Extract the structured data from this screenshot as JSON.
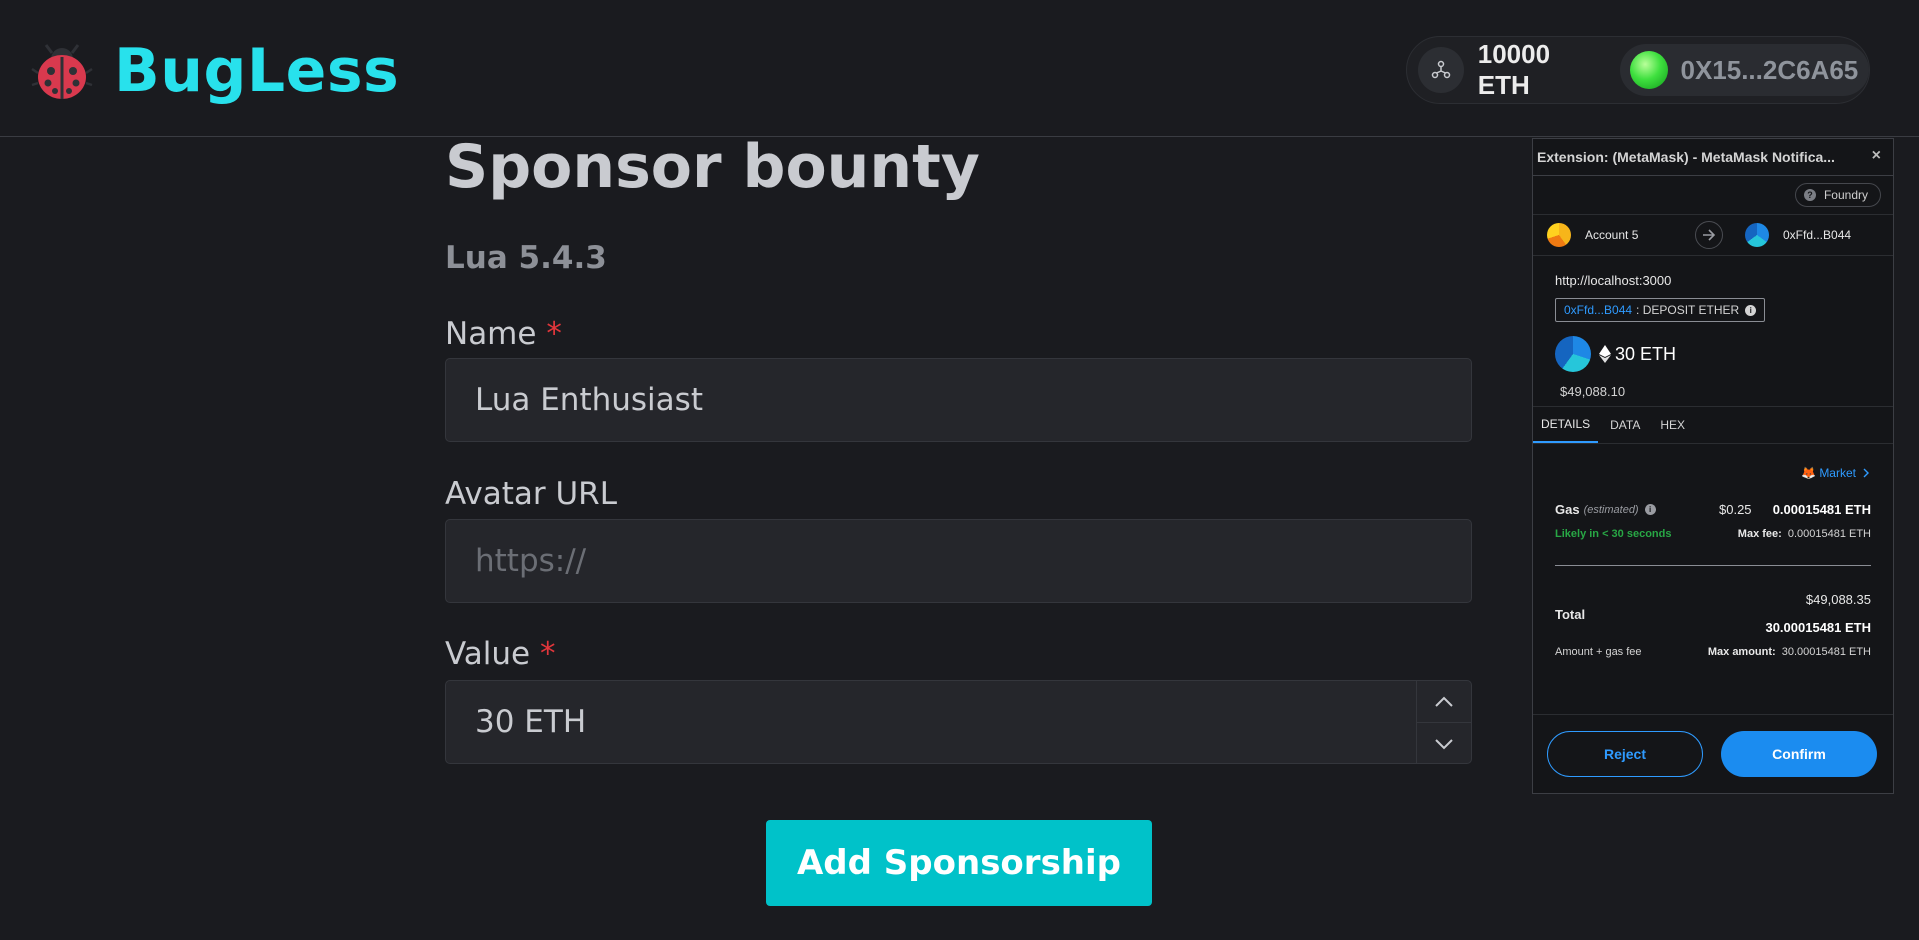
{
  "header": {
    "app_name": "BugLess",
    "logo_icon": "ladybug-icon",
    "network_icon": "network-icon",
    "balance": "10000 ETH",
    "address": "0X15...2C6A65",
    "accent_color": "#28e1ec"
  },
  "form": {
    "title": "Sponsor bounty",
    "subtitle": "Lua 5.4.3",
    "name_label": "Name",
    "name_required": "*",
    "name_value": "Lua Enthusiast",
    "avatar_label": "Avatar URL",
    "avatar_placeholder": "https://",
    "value_label": "Value",
    "value_required": "*",
    "value_value": "30 ETH",
    "submit_label": "Add Sponsorship",
    "button_color": "#00c2c9"
  },
  "metamask": {
    "window_title": "Extension: (MetaMask) - MetaMask Notifica...",
    "close": "×",
    "network": "Foundry",
    "from_account": "Account 5",
    "to_account": "0xFfd...B044",
    "origin": "http://localhost:3000",
    "method_address": "0xFfd...B044",
    "method_name": ": DEPOSIT ETHER",
    "amount": "30 ETH",
    "amount_fiat": "$49,088.10",
    "tabs": [
      {
        "label": "DETAILS",
        "active": true
      },
      {
        "label": "DATA",
        "active": false
      },
      {
        "label": "HEX",
        "active": false
      }
    ],
    "market": "Market",
    "gas_label": "Gas",
    "gas_estimated": "(estimated)",
    "gas_fiat": "$0.25",
    "gas_eth": "0.00015481 ETH",
    "likely": "Likely in < 30 seconds",
    "max_fee_label": "Max fee:",
    "max_fee_value": "0.00015481 ETH",
    "total_fiat": "$49,088.35",
    "total_label": "Total",
    "total_eth": "30.00015481 ETH",
    "amount_gas_fee": "Amount + gas fee",
    "max_amount_label": "Max amount:",
    "max_amount_value": "30.00015481 ETH",
    "reject_label": "Reject",
    "confirm_label": "Confirm",
    "primary_color": "#1b8cf0"
  }
}
